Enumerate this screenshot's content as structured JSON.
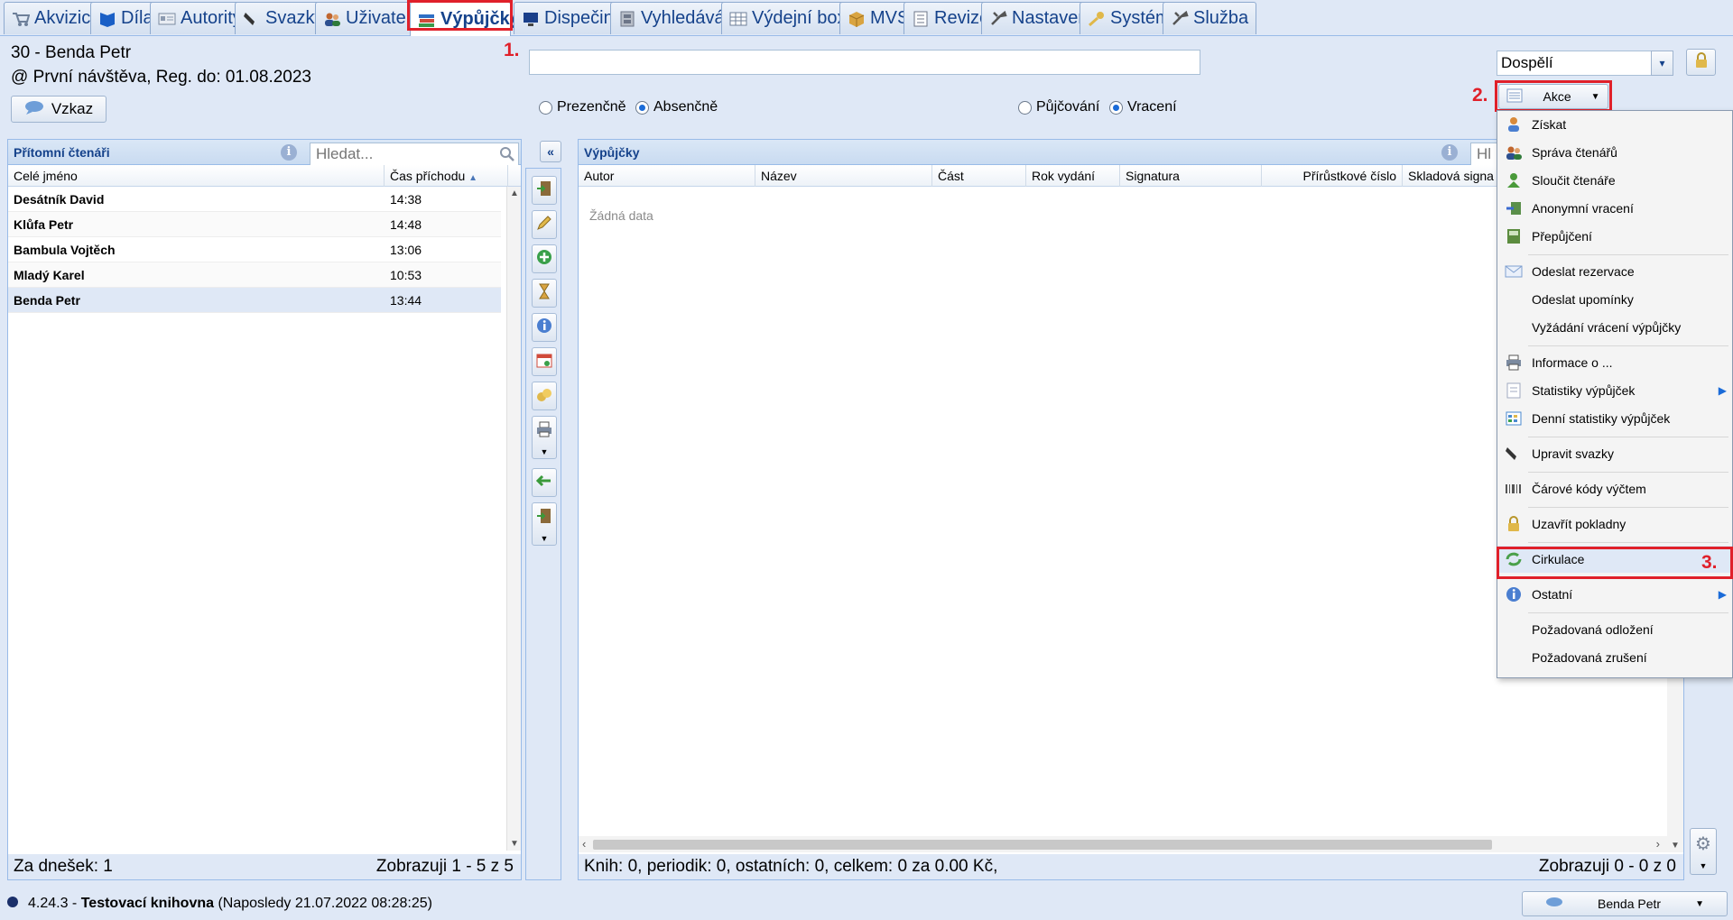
{
  "tabs": [
    {
      "label": "Akvizice",
      "icon": "cart-icon",
      "active": false
    },
    {
      "label": "Díla",
      "icon": "book-icon",
      "active": false
    },
    {
      "label": "Autority",
      "icon": "card-icon",
      "active": false
    },
    {
      "label": "Svazky",
      "icon": "scanner-icon",
      "active": false
    },
    {
      "label": "Uživatelé",
      "icon": "users-icon",
      "active": false
    },
    {
      "label": "Výpůjčky",
      "icon": "books-icon",
      "active": true
    },
    {
      "label": "Dispečink",
      "icon": "monitor-icon",
      "active": false
    },
    {
      "label": "Vyhledávání",
      "icon": "search-cabinet-icon",
      "active": false
    },
    {
      "label": "Výdejní boxy",
      "icon": "grid-box-icon",
      "active": false
    },
    {
      "label": "MVS",
      "icon": "package-icon",
      "active": false
    },
    {
      "label": "Revize",
      "icon": "document-icon",
      "active": false
    },
    {
      "label": "Nastavení",
      "icon": "tools-icon",
      "active": false
    },
    {
      "label": "Systém",
      "icon": "key-icon",
      "active": false
    },
    {
      "label": "Služba",
      "icon": "tools-icon",
      "active": false
    }
  ],
  "markers": {
    "m1": "1.",
    "m2": "2.",
    "m3": "3."
  },
  "reader": {
    "name_line": "30 - Benda Petr",
    "visit_line": "@ První návštěva, Reg. do: 01.08.2023",
    "message_button": "Vzkaz"
  },
  "scan_input": {
    "value": ""
  },
  "category_select": {
    "value": "Dospělí"
  },
  "loan_type": {
    "option1": "Prezenčně",
    "option2": "Absenčně",
    "selected": "Absenčně"
  },
  "mode": {
    "option1": "Půjčování",
    "option2": "Vracení",
    "selected": "Vracení"
  },
  "actions_button": {
    "label": "Akce"
  },
  "present_readers": {
    "title": "Přítomní čtenáři",
    "search_placeholder": "Hledat...",
    "columns": [
      "Celé jméno",
      "Čas příchodu"
    ],
    "rows": [
      {
        "name": "Desátník David",
        "time": "14:38"
      },
      {
        "name": "Klůfa Petr",
        "time": "14:48"
      },
      {
        "name": "Bambula Vojtěch",
        "time": "13:06"
      },
      {
        "name": "Mladý Karel",
        "time": "10:53"
      },
      {
        "name": "Benda Petr",
        "time": "13:44"
      }
    ],
    "status_left": "Za dnešek: 1",
    "status_right": "Zobrazuji 1 - 5 z 5"
  },
  "loans": {
    "title": "Výpůjčky",
    "search_placeholder": "Hl",
    "columns": [
      "Autor",
      "Název",
      "Část",
      "Rok vydání",
      "Signatura",
      "Přírůstkové číslo",
      "Skladová signa"
    ],
    "empty_text": "Žádná data",
    "status_left": "Knih: 0, periodik: 0, ostatních: 0, celkem: 0 za 0.00 Kč,",
    "status_right": "Zobrazuji 0 - 0 z 0"
  },
  "menu": {
    "items": [
      {
        "label": "Získat",
        "icon": "person-add-icon",
        "color": "#d98a3a"
      },
      {
        "label": "Správa čtenářů",
        "icon": "users-icon",
        "color": "#c0662f"
      },
      {
        "label": "Sloučit čtenáře",
        "icon": "merge-users-icon",
        "color": "#4a9a3a"
      },
      {
        "label": "Anonymní vracení",
        "icon": "return-icon",
        "color": "#5a8f4a"
      },
      {
        "label": "Přepůjčení",
        "icon": "renew-icon",
        "color": "#5c8c3f"
      },
      {
        "label": "Odeslat rezervace",
        "icon": "mail-icon",
        "color": "#7fa0d0"
      },
      {
        "label": "Odeslat upomínky",
        "icon": "",
        "color": ""
      },
      {
        "label": "Vyžádání vrácení výpůjčky",
        "icon": "",
        "color": ""
      },
      {
        "label": "Informace o ...",
        "icon": "printer-icon",
        "color": "#7b8aa0"
      },
      {
        "label": "Statistiky výpůjček",
        "icon": "stats-doc-icon",
        "color": "#c0c8d8"
      },
      {
        "label": "Denní statistiky výpůjček",
        "icon": "calendar-grid-icon",
        "color": "#4a8ad0"
      },
      {
        "label": "Upravit svazky",
        "icon": "scanner-icon",
        "color": "#555555"
      },
      {
        "label": "Čárové kódy výčtem",
        "icon": "barcode-icon",
        "color": "#555555"
      },
      {
        "label": "Uzavřít pokladny",
        "icon": "lock-icon",
        "color": "#d9b64a"
      },
      {
        "label": "Cirkulace",
        "icon": "cycle-icon",
        "color": "#4aa04a"
      },
      {
        "label": "Ostatní",
        "icon": "info-icon",
        "color": "#4a7ed0"
      },
      {
        "label": "Požadovaná odložení",
        "icon": "",
        "color": ""
      },
      {
        "label": "Požadovaná zrušení",
        "icon": "",
        "color": ""
      }
    ]
  },
  "footer": {
    "version": "4.24.3 - ",
    "library": "Testovací knihovna",
    "last_login": " (Naposledy 21.07.2022 08:28:25)",
    "user_button": "Benda Petr"
  },
  "colors": {
    "accent": "#15428b",
    "highlight": "#e0202a",
    "panel_bg": "#dfe8f6"
  }
}
